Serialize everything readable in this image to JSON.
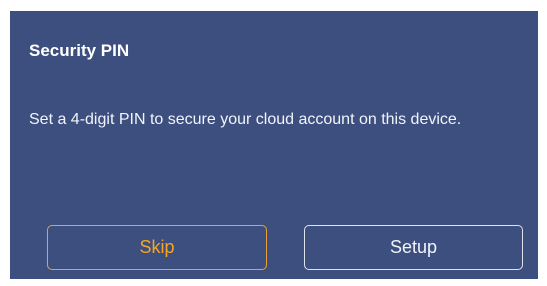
{
  "dialog": {
    "title": "Security PIN",
    "message": "Set a 4-digit PIN to secure your cloud account on this device.",
    "buttons": {
      "skip_label": "Skip",
      "setup_label": "Setup"
    }
  },
  "colors": {
    "dialog_background": "#3d4f7f",
    "accent": "#f5a623",
    "text": "#ffffff"
  }
}
